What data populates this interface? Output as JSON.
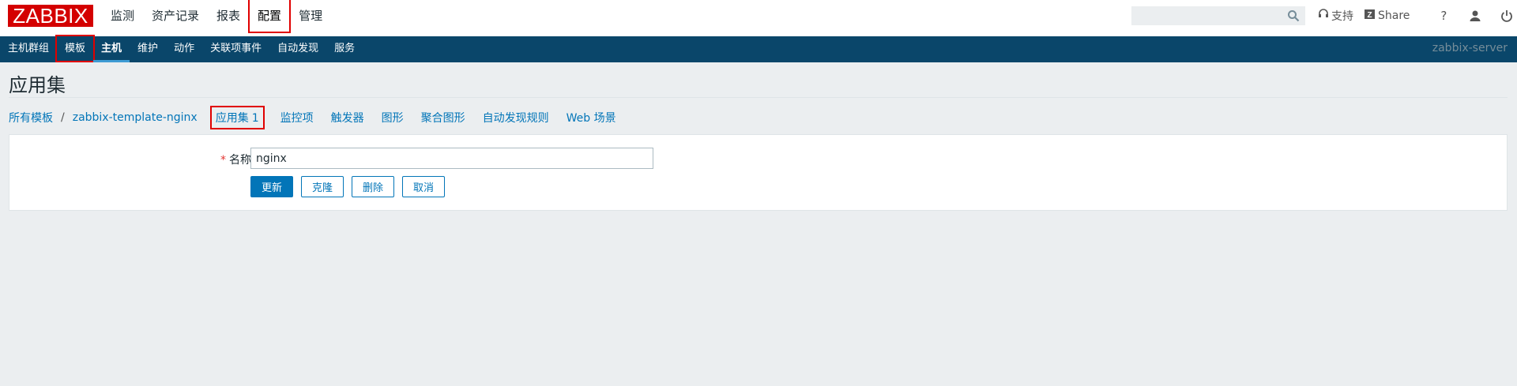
{
  "app": {
    "logo": "ZABBIX"
  },
  "main_menu": [
    {
      "label": "监测"
    },
    {
      "label": "资产记录"
    },
    {
      "label": "报表"
    },
    {
      "label": "配置"
    },
    {
      "label": "管理"
    }
  ],
  "header": {
    "search_placeholder": "",
    "support_label": "支持",
    "share_label": "Share",
    "help_label": "?"
  },
  "sub_menu": [
    {
      "label": "主机群组"
    },
    {
      "label": "模板"
    },
    {
      "label": "主机"
    },
    {
      "label": "维护"
    },
    {
      "label": "动作"
    },
    {
      "label": "关联项事件"
    },
    {
      "label": "自动发现"
    },
    {
      "label": "服务"
    }
  ],
  "server_name": "zabbix-server",
  "page": {
    "title": "应用集"
  },
  "breadcrumb": {
    "all_templates": "所有模板",
    "separator": "/",
    "template": "zabbix-template-nginx"
  },
  "tabs": [
    {
      "label": "应用集",
      "count": "1"
    },
    {
      "label": "监控项"
    },
    {
      "label": "触发器"
    },
    {
      "label": "图形"
    },
    {
      "label": "聚合图形"
    },
    {
      "label": "自动发现规则"
    },
    {
      "label": "Web 场景"
    }
  ],
  "form": {
    "required_mark": "*",
    "name_label": "名称",
    "name_value": "nginx"
  },
  "buttons": {
    "update": "更新",
    "clone": "克隆",
    "delete": "删除",
    "cancel": "取消"
  },
  "colors": {
    "brand_red": "#d40000",
    "nav_blue": "#0a466a",
    "link_blue": "#0275b8",
    "highlight_red": "#e00000"
  }
}
